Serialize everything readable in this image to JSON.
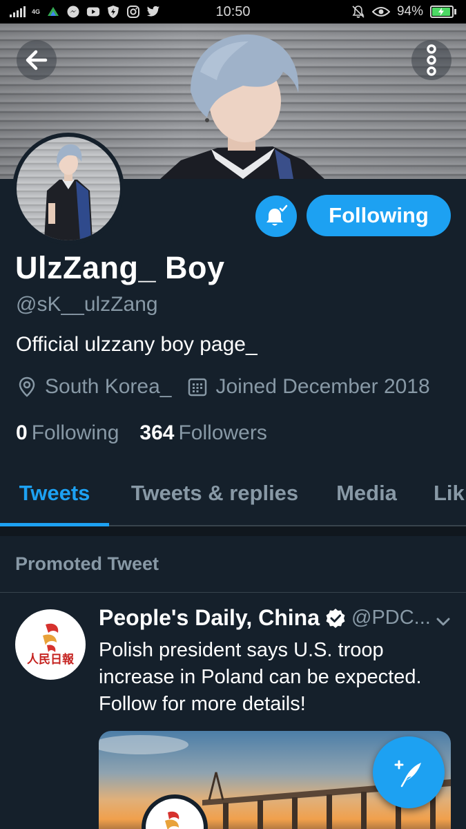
{
  "status_bar": {
    "time": "10:50",
    "network": "4G",
    "battery_percent": "94%",
    "battery_level": 0.94,
    "left_icons": [
      "signal-icon",
      "maps-icon",
      "messenger-icon",
      "youtube-icon",
      "shield-icon",
      "instagram-icon",
      "twitter-icon"
    ],
    "right_icons": [
      "bell-off-icon",
      "eye-icon",
      "battery-icon"
    ]
  },
  "profile": {
    "name": "UlzZang_ Boy",
    "handle": "@sK__ulzZang",
    "bio": "Official ulzzany boy page_",
    "location": "South Korea_",
    "joined": "Joined December 2018",
    "following_count": "0",
    "following_label": "Following",
    "followers_count": "364",
    "followers_label": "Followers",
    "follow_button": "Following"
  },
  "tabs": [
    {
      "label": "Tweets",
      "active": true
    },
    {
      "label": "Tweets & replies",
      "active": false
    },
    {
      "label": "Media",
      "active": false
    },
    {
      "label": "Lik",
      "active": false
    }
  ],
  "promoted": {
    "label": "Promoted Tweet"
  },
  "tweet": {
    "name": "People's Daily, China",
    "handle": "@PDC...",
    "lines": [
      "Polish president says U.S. troop",
      "increase in Poland can be expected.",
      "Follow for more details!"
    ]
  },
  "colors": {
    "background": "#15202b",
    "accent": "#1da1f2",
    "secondary_text": "#8899a6",
    "divider": "#38444d"
  }
}
